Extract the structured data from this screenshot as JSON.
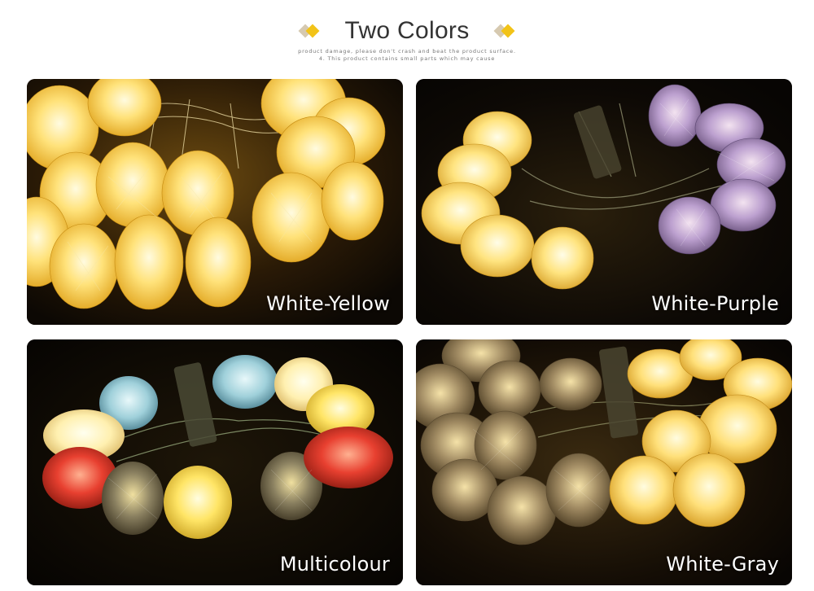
{
  "header": {
    "title": "Two Colors",
    "fine_print": [
      "product damage, please don't crash and beat the product surface.",
      "4. This product contains small parts which may cause"
    ],
    "left_diamond_colors": [
      "#d6c9b0",
      "#f2c318"
    ],
    "right_diamond_colors": [
      "#d6c9b0",
      "#f2c318"
    ]
  },
  "panels": [
    {
      "label": "White-Yellow",
      "image": "yellow-egg-lights-photo",
      "bulb_colors": [
        "#ffd24a"
      ]
    },
    {
      "label": "White-Purple",
      "image": "white-purple-egg-lights-photo",
      "bulb_colors": [
        "#ffe07a",
        "#b89bd0"
      ]
    },
    {
      "label": "Multicolour",
      "image": "multicolour-egg-lights-photo",
      "bulb_colors": [
        "#fff0b0",
        "#e84030",
        "#9fd0da",
        "#8a8060",
        "#ffe566"
      ]
    },
    {
      "label": "White-Gray",
      "image": "white-gray-egg-lights-photo",
      "bulb_colors": [
        "#ffe07a",
        "#a08a62"
      ]
    }
  ]
}
